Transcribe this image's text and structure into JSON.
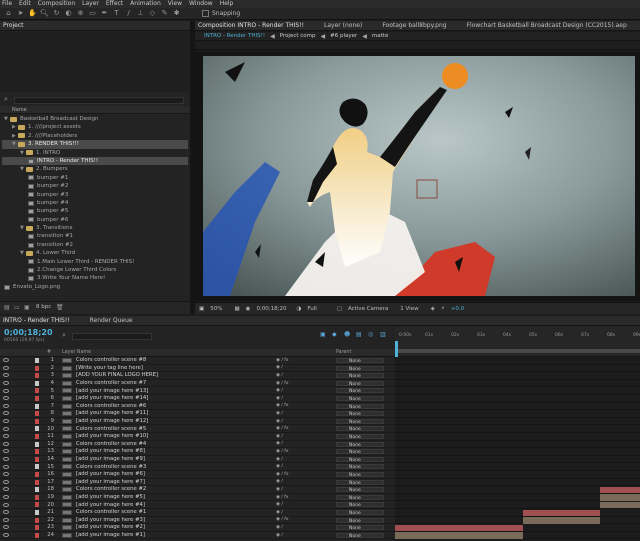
{
  "menu": [
    "File",
    "Edit",
    "Composition",
    "Layer",
    "Effect",
    "Animation",
    "View",
    "Window",
    "Help"
  ],
  "toolbar": {
    "snapping_label": "Snapping"
  },
  "project": {
    "title": "Project",
    "column_name": "Name",
    "items": [
      {
        "label": "Basketball Broadcast Design",
        "indent": 0,
        "kind": "folder",
        "open": true
      },
      {
        "label": "1. ////project assets",
        "indent": 1,
        "kind": "folder",
        "open": false
      },
      {
        "label": "2. ////Placeholders",
        "indent": 1,
        "kind": "folder",
        "open": false
      },
      {
        "label": "3. RENDER THIS!!!",
        "indent": 1,
        "kind": "folder",
        "open": true,
        "selected": true
      },
      {
        "label": "1. INTRO",
        "indent": 2,
        "kind": "folder",
        "open": true
      },
      {
        "label": "INTRO - Render THIS!!",
        "indent": 3,
        "kind": "comp",
        "selected": true
      },
      {
        "label": "2. Bumpers",
        "indent": 2,
        "kind": "folder",
        "open": true
      },
      {
        "label": "bumper #1",
        "indent": 3,
        "kind": "comp"
      },
      {
        "label": "bumper #2",
        "indent": 3,
        "kind": "comp"
      },
      {
        "label": "bumper #3",
        "indent": 3,
        "kind": "comp"
      },
      {
        "label": "bumper #4",
        "indent": 3,
        "kind": "comp"
      },
      {
        "label": "bumper #5",
        "indent": 3,
        "kind": "comp"
      },
      {
        "label": "bumper #6",
        "indent": 3,
        "kind": "comp"
      },
      {
        "label": "3. Transitions",
        "indent": 2,
        "kind": "folder",
        "open": true
      },
      {
        "label": "transition #1",
        "indent": 3,
        "kind": "comp"
      },
      {
        "label": "transition #2",
        "indent": 3,
        "kind": "comp"
      },
      {
        "label": "4. Lower Third",
        "indent": 2,
        "kind": "folder",
        "open": true
      },
      {
        "label": "1.Main Lower Third - RENDER THIS!",
        "indent": 3,
        "kind": "comp"
      },
      {
        "label": "2.Change Lower Third Colors",
        "indent": 3,
        "kind": "comp"
      },
      {
        "label": "3.Write Your Name Here!",
        "indent": 3,
        "kind": "comp"
      },
      {
        "label": "Envato_Logo.png",
        "indent": 0,
        "kind": "image"
      }
    ],
    "bpc": "8 bpc"
  },
  "viewer_tabs": [
    {
      "label": "Composition INTRO - Render THIS!!",
      "active": true
    },
    {
      "label": "Layer (none)"
    },
    {
      "label": "Footage ball8bpy.png"
    },
    {
      "label": "Flowchart Basketball Broadcast Design (CC2015).aep"
    }
  ],
  "comp_breadcrumbs": [
    "INTRO - Render THIS!!",
    "Project comp",
    "#6 player",
    "matte"
  ],
  "viewer_footer": {
    "zoom": "50%",
    "timecode": "0;00;18;20",
    "resolution": "Full",
    "camera": "Active Camera",
    "views": "1 View",
    "exposure": "+0.0"
  },
  "timeline": {
    "tabs": [
      "INTRO - Render THIS!!",
      "Render Queue"
    ],
    "timecode": "0;00;18;20",
    "frame_info": "00560 (29.97 fps)",
    "col_num": "#",
    "col_layer": "Layer Name",
    "col_parent": "Parent",
    "ruler": [
      "0:00s",
      "01s",
      "02s",
      "03s",
      "04s",
      "05s",
      "06s",
      "07s",
      "08s",
      "09s"
    ],
    "layers": [
      {
        "n": "1",
        "name": "Colors controller scene #8",
        "color": "#c8c8c8"
      },
      {
        "n": "2",
        "name": "[Write your tag line here]",
        "color": "#c44a4a"
      },
      {
        "n": "3",
        "name": "[ADD YOUR FINAL LOGO HERE]",
        "color": "#c44a4a"
      },
      {
        "n": "4",
        "name": "Colors controller scene #7",
        "color": "#c8c8c8"
      },
      {
        "n": "5",
        "name": "[add your image here #13]",
        "color": "#c44a4a"
      },
      {
        "n": "6",
        "name": "[add your image here #14]",
        "color": "#c44a4a"
      },
      {
        "n": "7",
        "name": "Colors controller scene #6",
        "color": "#c8c8c8"
      },
      {
        "n": "8",
        "name": "[add your image here #11]",
        "color": "#c44a4a"
      },
      {
        "n": "9",
        "name": "[add your image here #12]",
        "color": "#c44a4a"
      },
      {
        "n": "10",
        "name": "Colors controller scene #5",
        "color": "#c8c8c8"
      },
      {
        "n": "11",
        "name": "[add your image here #10]",
        "color": "#c44a4a"
      },
      {
        "n": "12",
        "name": "Colors controller scene #4",
        "color": "#c8c8c8"
      },
      {
        "n": "13",
        "name": "[add your image here #8]",
        "color": "#c44a4a"
      },
      {
        "n": "14",
        "name": "[add your image here #9]",
        "color": "#c44a4a"
      },
      {
        "n": "15",
        "name": "Colors controller scene #3",
        "color": "#c8c8c8"
      },
      {
        "n": "16",
        "name": "[add your image here #6]",
        "color": "#c44a4a"
      },
      {
        "n": "17",
        "name": "[add your image here #7]",
        "color": "#c44a4a"
      },
      {
        "n": "18",
        "name": "Colors controller scene #2",
        "color": "#c8c8c8"
      },
      {
        "n": "19",
        "name": "[add your image here #5]",
        "color": "#c44a4a"
      },
      {
        "n": "20",
        "name": "[add your image here #4]",
        "color": "#c44a4a"
      },
      {
        "n": "21",
        "name": "Colors controller scene #1",
        "color": "#c8c8c8"
      },
      {
        "n": "22",
        "name": "[add your image here #3]",
        "color": "#c44a4a"
      },
      {
        "n": "23",
        "name": "[add your image here #2]",
        "color": "#c44a4a"
      },
      {
        "n": "24",
        "name": "[add your image here #1]",
        "color": "#c44a4a"
      }
    ],
    "parent_value": "None"
  }
}
